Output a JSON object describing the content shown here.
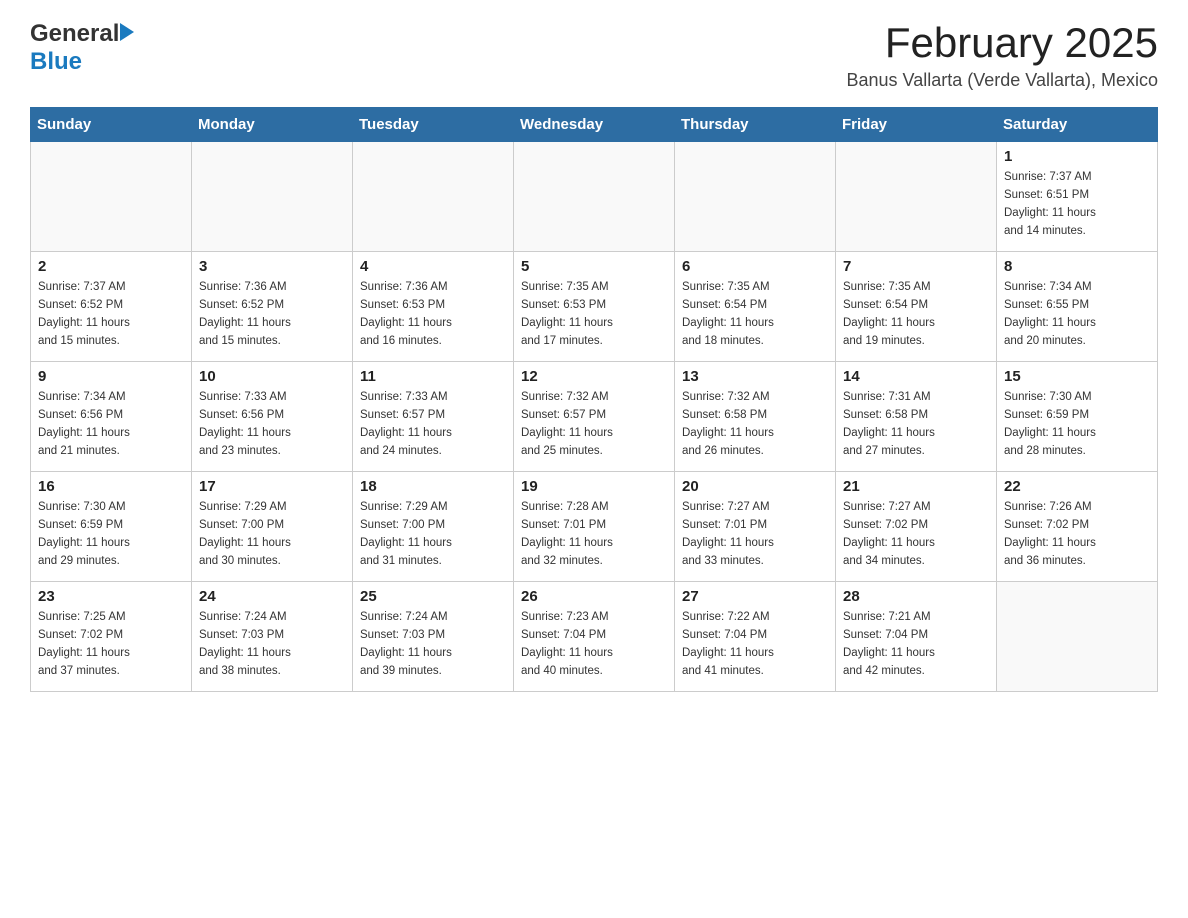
{
  "header": {
    "logo_general": "General",
    "logo_blue": "Blue",
    "month_year": "February 2025",
    "location": "Banus Vallarta (Verde Vallarta), Mexico"
  },
  "days_of_week": [
    "Sunday",
    "Monday",
    "Tuesday",
    "Wednesday",
    "Thursday",
    "Friday",
    "Saturday"
  ],
  "weeks": [
    [
      {
        "day": "",
        "info": ""
      },
      {
        "day": "",
        "info": ""
      },
      {
        "day": "",
        "info": ""
      },
      {
        "day": "",
        "info": ""
      },
      {
        "day": "",
        "info": ""
      },
      {
        "day": "",
        "info": ""
      },
      {
        "day": "1",
        "info": "Sunrise: 7:37 AM\nSunset: 6:51 PM\nDaylight: 11 hours\nand 14 minutes."
      }
    ],
    [
      {
        "day": "2",
        "info": "Sunrise: 7:37 AM\nSunset: 6:52 PM\nDaylight: 11 hours\nand 15 minutes."
      },
      {
        "day": "3",
        "info": "Sunrise: 7:36 AM\nSunset: 6:52 PM\nDaylight: 11 hours\nand 15 minutes."
      },
      {
        "day": "4",
        "info": "Sunrise: 7:36 AM\nSunset: 6:53 PM\nDaylight: 11 hours\nand 16 minutes."
      },
      {
        "day": "5",
        "info": "Sunrise: 7:35 AM\nSunset: 6:53 PM\nDaylight: 11 hours\nand 17 minutes."
      },
      {
        "day": "6",
        "info": "Sunrise: 7:35 AM\nSunset: 6:54 PM\nDaylight: 11 hours\nand 18 minutes."
      },
      {
        "day": "7",
        "info": "Sunrise: 7:35 AM\nSunset: 6:54 PM\nDaylight: 11 hours\nand 19 minutes."
      },
      {
        "day": "8",
        "info": "Sunrise: 7:34 AM\nSunset: 6:55 PM\nDaylight: 11 hours\nand 20 minutes."
      }
    ],
    [
      {
        "day": "9",
        "info": "Sunrise: 7:34 AM\nSunset: 6:56 PM\nDaylight: 11 hours\nand 21 minutes."
      },
      {
        "day": "10",
        "info": "Sunrise: 7:33 AM\nSunset: 6:56 PM\nDaylight: 11 hours\nand 23 minutes."
      },
      {
        "day": "11",
        "info": "Sunrise: 7:33 AM\nSunset: 6:57 PM\nDaylight: 11 hours\nand 24 minutes."
      },
      {
        "day": "12",
        "info": "Sunrise: 7:32 AM\nSunset: 6:57 PM\nDaylight: 11 hours\nand 25 minutes."
      },
      {
        "day": "13",
        "info": "Sunrise: 7:32 AM\nSunset: 6:58 PM\nDaylight: 11 hours\nand 26 minutes."
      },
      {
        "day": "14",
        "info": "Sunrise: 7:31 AM\nSunset: 6:58 PM\nDaylight: 11 hours\nand 27 minutes."
      },
      {
        "day": "15",
        "info": "Sunrise: 7:30 AM\nSunset: 6:59 PM\nDaylight: 11 hours\nand 28 minutes."
      }
    ],
    [
      {
        "day": "16",
        "info": "Sunrise: 7:30 AM\nSunset: 6:59 PM\nDaylight: 11 hours\nand 29 minutes."
      },
      {
        "day": "17",
        "info": "Sunrise: 7:29 AM\nSunset: 7:00 PM\nDaylight: 11 hours\nand 30 minutes."
      },
      {
        "day": "18",
        "info": "Sunrise: 7:29 AM\nSunset: 7:00 PM\nDaylight: 11 hours\nand 31 minutes."
      },
      {
        "day": "19",
        "info": "Sunrise: 7:28 AM\nSunset: 7:01 PM\nDaylight: 11 hours\nand 32 minutes."
      },
      {
        "day": "20",
        "info": "Sunrise: 7:27 AM\nSunset: 7:01 PM\nDaylight: 11 hours\nand 33 minutes."
      },
      {
        "day": "21",
        "info": "Sunrise: 7:27 AM\nSunset: 7:02 PM\nDaylight: 11 hours\nand 34 minutes."
      },
      {
        "day": "22",
        "info": "Sunrise: 7:26 AM\nSunset: 7:02 PM\nDaylight: 11 hours\nand 36 minutes."
      }
    ],
    [
      {
        "day": "23",
        "info": "Sunrise: 7:25 AM\nSunset: 7:02 PM\nDaylight: 11 hours\nand 37 minutes."
      },
      {
        "day": "24",
        "info": "Sunrise: 7:24 AM\nSunset: 7:03 PM\nDaylight: 11 hours\nand 38 minutes."
      },
      {
        "day": "25",
        "info": "Sunrise: 7:24 AM\nSunset: 7:03 PM\nDaylight: 11 hours\nand 39 minutes."
      },
      {
        "day": "26",
        "info": "Sunrise: 7:23 AM\nSunset: 7:04 PM\nDaylight: 11 hours\nand 40 minutes."
      },
      {
        "day": "27",
        "info": "Sunrise: 7:22 AM\nSunset: 7:04 PM\nDaylight: 11 hours\nand 41 minutes."
      },
      {
        "day": "28",
        "info": "Sunrise: 7:21 AM\nSunset: 7:04 PM\nDaylight: 11 hours\nand 42 minutes."
      },
      {
        "day": "",
        "info": ""
      }
    ]
  ]
}
